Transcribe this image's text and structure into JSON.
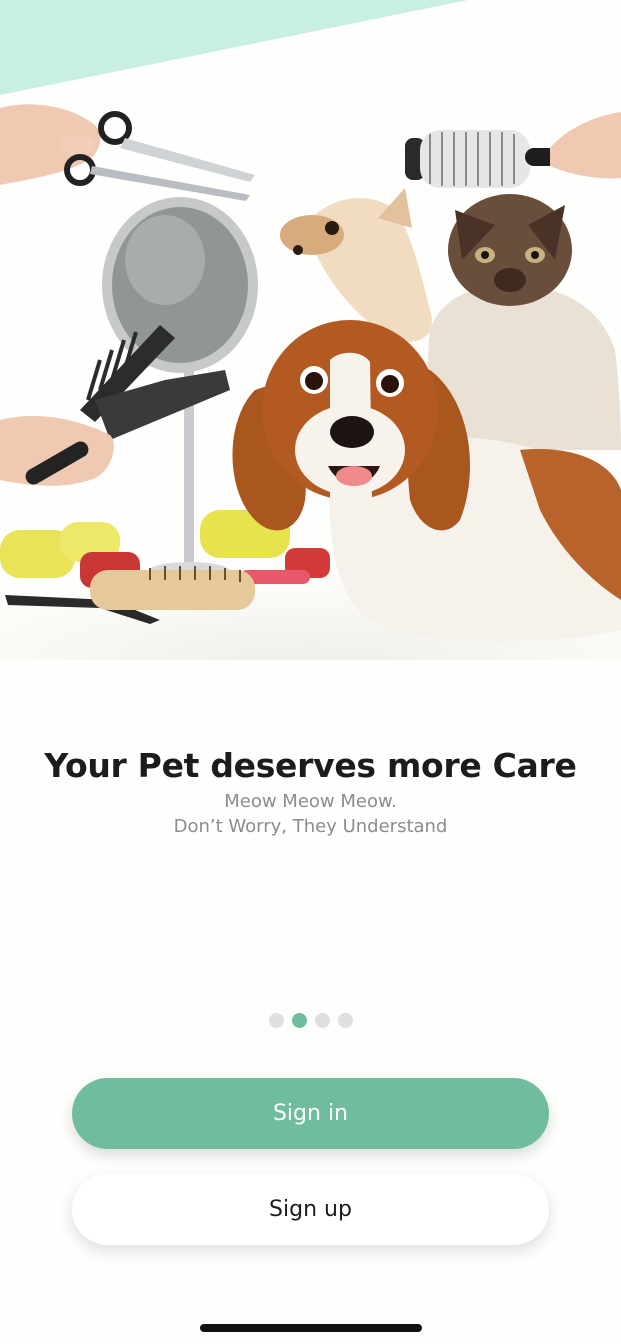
{
  "colors": {
    "accent": "#6fbd9c",
    "banner": "#c9efe0",
    "heading": "#1c1c1c",
    "subtext": "#8c8c8c",
    "dot_inactive": "#dfdfdf"
  },
  "hero": {
    "image": "pet-grooming-illustration"
  },
  "onboarding": {
    "title": "Your Pet deserves more Care",
    "subtitle_line1": "Meow Meow Meow.",
    "subtitle_line2": "Don’t Worry, They Understand",
    "pager": {
      "total": 4,
      "active_index": 1
    }
  },
  "actions": {
    "signin_label": "Sign in",
    "signup_label": "Sign up"
  }
}
